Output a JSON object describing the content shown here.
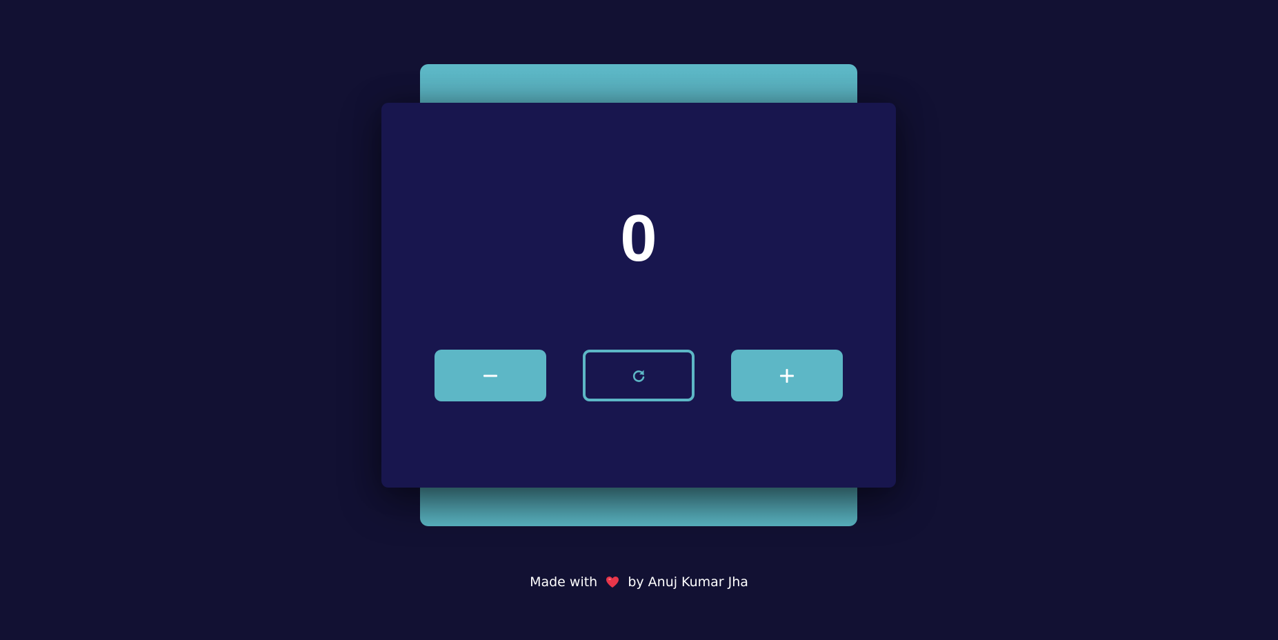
{
  "counter": {
    "value": "0"
  },
  "buttons": {
    "decrement": {
      "icon": "minus-icon"
    },
    "reset": {
      "icon": "refresh-icon"
    },
    "increment": {
      "icon": "plus-icon"
    }
  },
  "footer": {
    "prefix": "Made with",
    "heart_icon": "heart-icon",
    "suffix": "by Anuj Kumar Jha"
  },
  "colors": {
    "background": "#121133",
    "card": "#18164e",
    "accent": "#5db7c6",
    "heart": "#e8364a"
  }
}
